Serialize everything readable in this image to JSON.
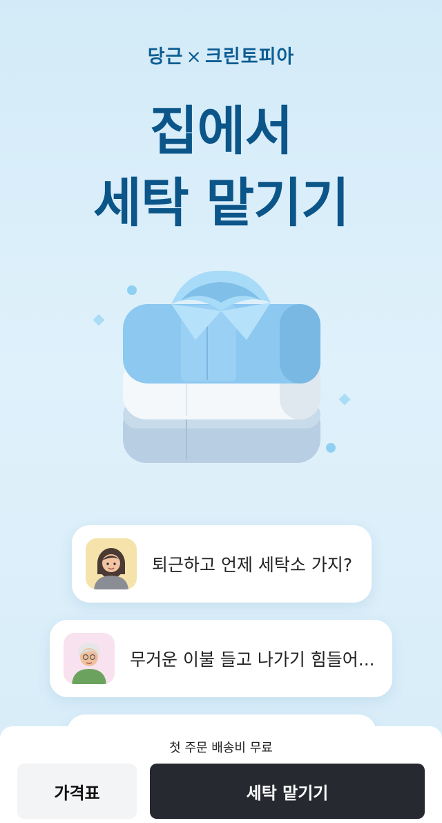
{
  "header": {
    "brand_left": "당근",
    "brand_cross": "×",
    "brand_right": "크린토피아",
    "headline_line1": "집에서",
    "headline_line2": "세탁 맡기기"
  },
  "illustration": {
    "icon": "folded-shirts-icon"
  },
  "testimonials": [
    {
      "avatar": "woman-avatar-icon",
      "text": "퇴근하고 언제 세탁소 가지?"
    },
    {
      "avatar": "grandma-avatar-icon",
      "text": "무거운 이불 들고 나가기 힘들어..."
    }
  ],
  "bottom_bar": {
    "notice": "첫 주문 배송비 무료",
    "price_button": "가격표",
    "main_button": "세탁 맡기기"
  },
  "colors": {
    "accent": "#0b5589",
    "background": "#d7ecf8",
    "cta": "#262a30"
  }
}
